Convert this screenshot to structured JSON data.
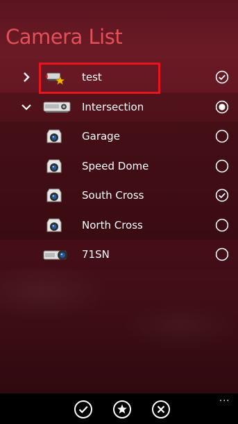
{
  "page": {
    "title": "Camera List"
  },
  "cameras": [
    {
      "label": "test",
      "checked": true,
      "icon": "favorite-dvr-icon",
      "expander": "collapsed"
    },
    {
      "label": "Intersection",
      "checked": "filled",
      "icon": "dvr-icon",
      "expander": "expanded"
    },
    {
      "label": "Garage",
      "checked": false,
      "icon": "camera-icon"
    },
    {
      "label": "Speed Dome",
      "checked": false,
      "icon": "camera-icon"
    },
    {
      "label": "South Cross",
      "checked": true,
      "icon": "camera-icon"
    },
    {
      "label": "North Cross",
      "checked": false,
      "icon": "camera-icon"
    },
    {
      "label": "71SN",
      "checked": false,
      "icon": "dvr-camera-icon"
    }
  ],
  "appbar": {
    "buttons": [
      "check-icon",
      "star-icon",
      "close-icon"
    ],
    "more": "..."
  },
  "colors": {
    "title": "#e2505a",
    "highlight": "#e8141e",
    "background": "#5a1420"
  }
}
